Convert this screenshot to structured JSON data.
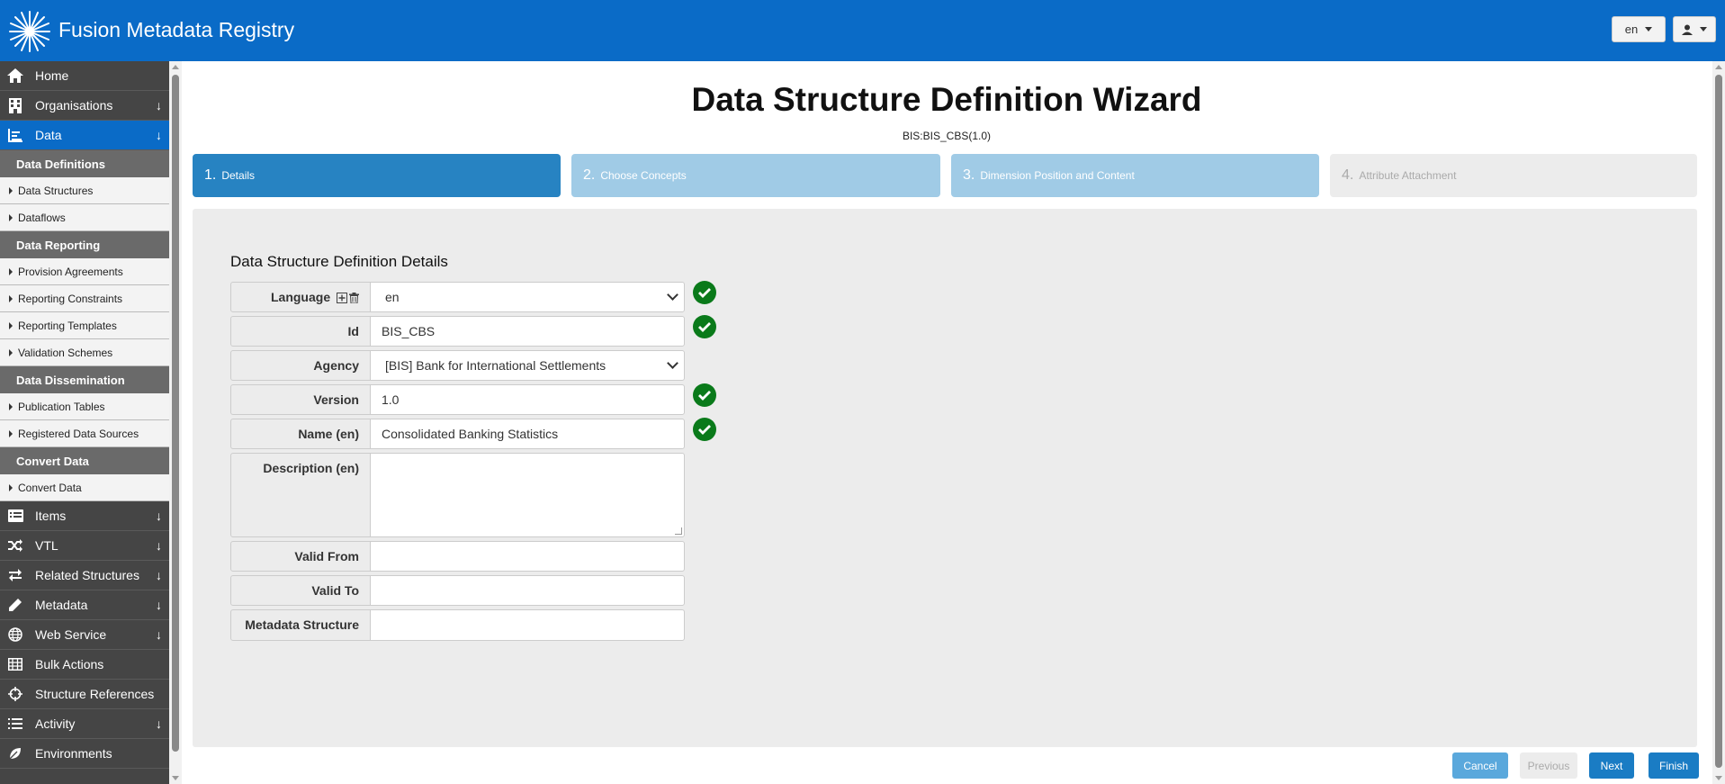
{
  "header": {
    "app_title": "Fusion Metadata Registry",
    "language_button": "en",
    "brand_color": "#0a6bc7"
  },
  "sidebar": {
    "items_top": [
      {
        "label": "Home",
        "icon": "home-icon"
      },
      {
        "label": "Organisations",
        "icon": "building-icon"
      },
      {
        "label": "Data",
        "icon": "chart-icon"
      }
    ],
    "groups": [
      {
        "heading": "Data Definitions",
        "items": [
          "Data Structures",
          "Dataflows"
        ]
      },
      {
        "heading": "Data Reporting",
        "items": [
          "Provision Agreements",
          "Reporting Constraints",
          "Reporting Templates",
          "Validation Schemes"
        ]
      },
      {
        "heading": "Data Dissemination",
        "items": [
          "Publication Tables",
          "Registered Data Sources"
        ]
      },
      {
        "heading": "Convert Data",
        "items": [
          "Convert Data"
        ]
      }
    ],
    "items_bottom": [
      {
        "label": "Items",
        "icon": "list-icon"
      },
      {
        "label": "VTL",
        "icon": "shuffle-icon"
      },
      {
        "label": "Related Structures",
        "icon": "exchange-icon"
      },
      {
        "label": "Metadata",
        "icon": "pencil-icon"
      },
      {
        "label": "Web Service",
        "icon": "globe-icon"
      },
      {
        "label": "Bulk Actions",
        "icon": "table-icon"
      },
      {
        "label": "Structure References",
        "icon": "crosshair-icon"
      },
      {
        "label": "Activity",
        "icon": "list-icon"
      },
      {
        "label": "Environments",
        "icon": "leaf-icon"
      }
    ]
  },
  "main": {
    "title": "Data Structure Definition Wizard",
    "subtitle": "BIS:BIS_CBS(1.0)",
    "steps": [
      {
        "num": "1.",
        "label": "Details"
      },
      {
        "num": "2.",
        "label": "Choose Concepts"
      },
      {
        "num": "3.",
        "label": "Dimension Position and Content"
      },
      {
        "num": "4.",
        "label": "Attribute Attachment"
      }
    ],
    "section_title": "Data Structure Definition Details",
    "fields": {
      "language": {
        "label": "Language",
        "value": "en"
      },
      "id": {
        "label": "Id",
        "value": "BIS_CBS"
      },
      "agency": {
        "label": "Agency",
        "value": "[BIS] Bank for International Settlements"
      },
      "version": {
        "label": "Version",
        "value": "1.0"
      },
      "name": {
        "label": "Name (en)",
        "value": "Consolidated Banking Statistics"
      },
      "description": {
        "label": "Description (en)",
        "value": ""
      },
      "valid_from": {
        "label": "Valid From",
        "value": ""
      },
      "valid_to": {
        "label": "Valid To",
        "value": ""
      },
      "metadata_structure": {
        "label": "Metadata Structure",
        "value": ""
      }
    }
  },
  "footer": {
    "cancel": "Cancel",
    "previous": "Previous",
    "next": "Next",
    "finish": "Finish"
  }
}
